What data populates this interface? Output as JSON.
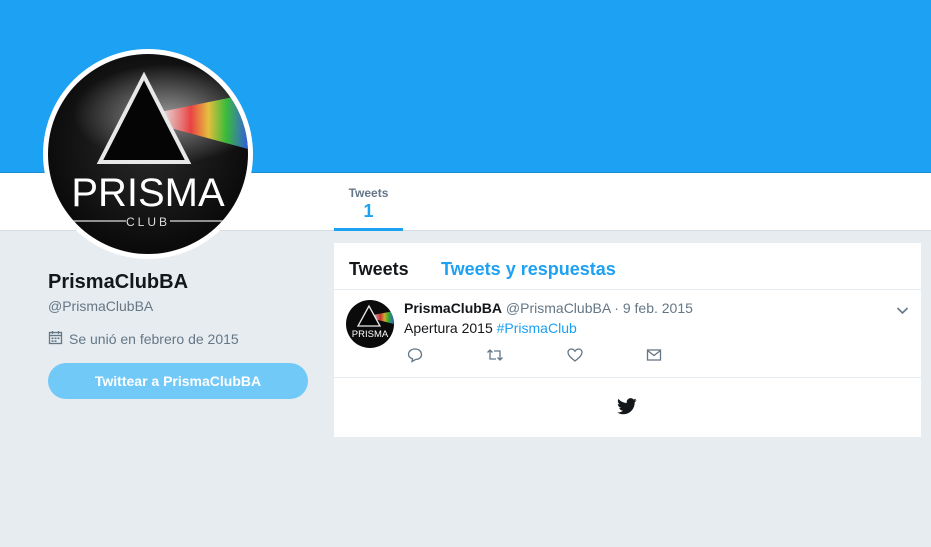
{
  "profile": {
    "name": "PrismaClubBA",
    "handle": "@PrismaClubBA",
    "joined": "Se unió en febrero de 2015",
    "tweet_to_button": "Twittear a PrismaClubBA",
    "avatar_text": "PRISMA",
    "avatar_subtext": "CLUB"
  },
  "stats": {
    "tweets_label": "Tweets",
    "tweets_count": "1"
  },
  "timeline": {
    "tabs": [
      {
        "label": "Tweets",
        "active": true
      },
      {
        "label": "Tweets y respuestas",
        "active": false
      }
    ],
    "tweets": [
      {
        "name": "PrismaClubBA",
        "handle": "@PrismaClubBA",
        "separator": "·",
        "date": "9 feb. 2015",
        "text": "Apertura 2015",
        "hashtag": "#PrismaClub",
        "actions": [
          "reply-icon",
          "retweet-icon",
          "like-icon",
          "dm-icon"
        ]
      }
    ]
  },
  "colors": {
    "brand": "#1da1f2",
    "background": "#e6ecf0",
    "button": "#71c9f8",
    "text_primary": "#14171a",
    "text_secondary": "#657786"
  }
}
